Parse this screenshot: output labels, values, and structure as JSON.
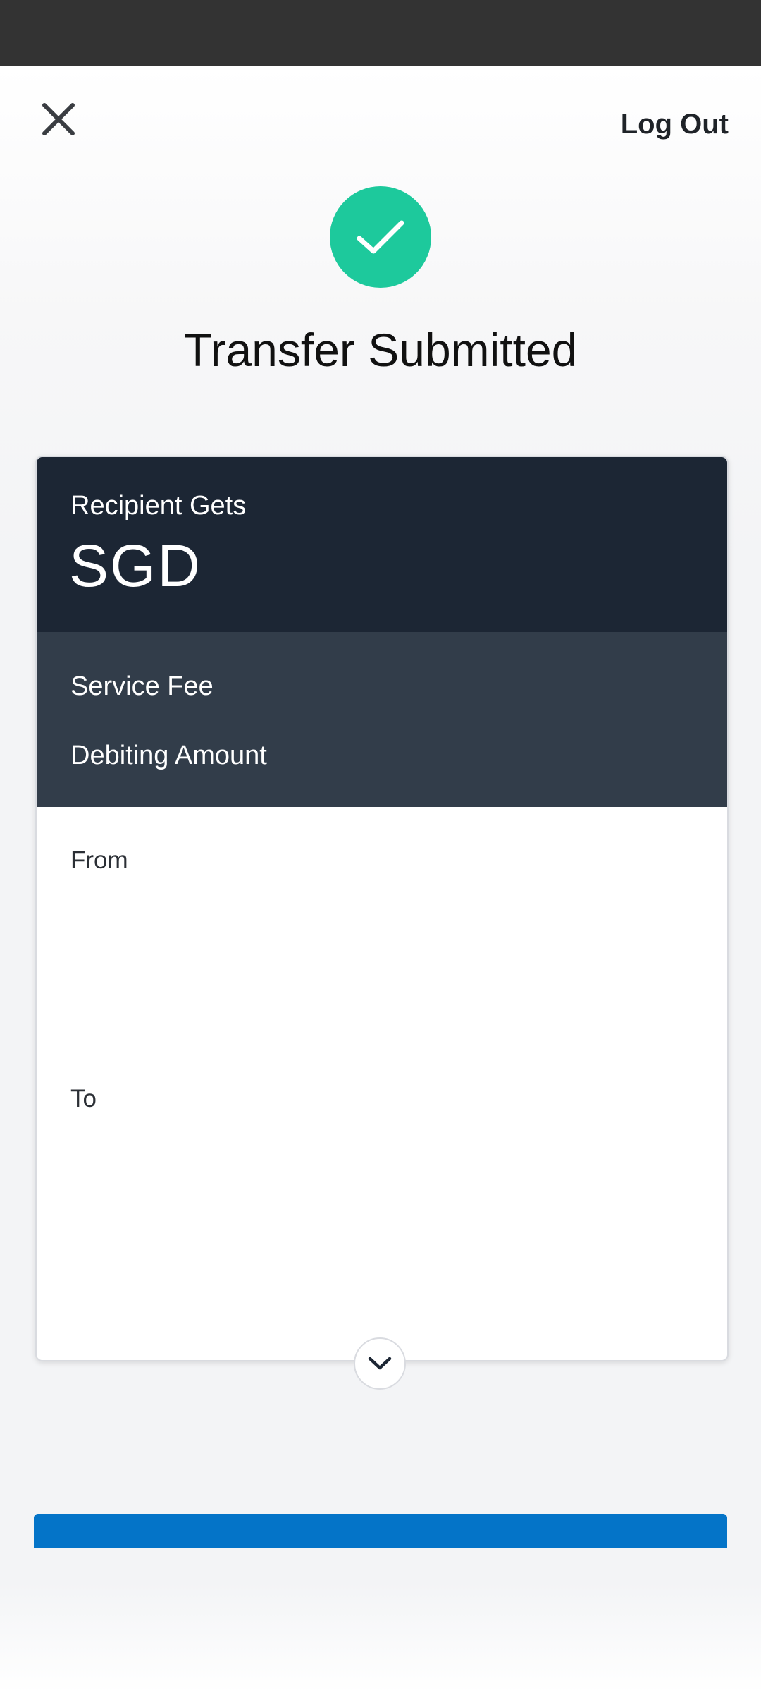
{
  "header": {
    "close_icon": "close-icon",
    "logout_label": "Log Out"
  },
  "status": {
    "icon": "checkmark-icon",
    "color": "#1dc99c",
    "title": "Transfer Submitted"
  },
  "summary": {
    "recipient_label": "Recipient Gets",
    "currency": "SGD",
    "service_fee_label": "Service Fee",
    "debiting_amount_label": "Debiting Amount",
    "from_label": "From",
    "to_label": "To"
  },
  "expand": {
    "icon": "chevron-down-icon"
  },
  "colors": {
    "card_header": "#1c2634",
    "card_fees": "#323d4a",
    "primary_button": "#0474c8"
  }
}
